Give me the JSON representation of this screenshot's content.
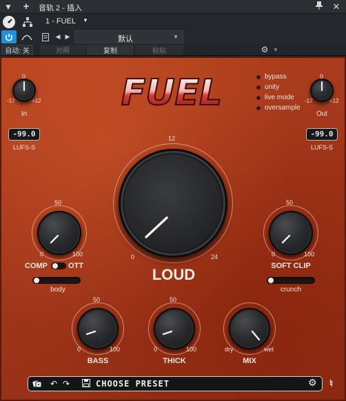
{
  "window": {
    "title": "音轨 2 - 插入",
    "menu_icon": "triangle-down-icon",
    "add_icon": "plus-icon",
    "pin_icon": "pin-icon",
    "close_icon": "close-icon"
  },
  "toolbar": {
    "power_icon": "power-icon",
    "routing_icon": "routing-icon",
    "plugin_selector": "1 - FUEL",
    "auto_label": "自动: 关",
    "compare_label": "对照",
    "copy_label": "复制",
    "paste_label": "粘贴",
    "preset_name": "默认"
  },
  "plugin": {
    "logo": "FUEL",
    "options": [
      "bypass",
      "unity",
      "live mode",
      "oversample"
    ],
    "in": {
      "label": "In",
      "min": "-17",
      "max": "+12",
      "center": "0",
      "lufs": "-99.0",
      "lufs_label": "LUFS-S"
    },
    "out": {
      "label": "Out",
      "min": "-17",
      "max": "+12",
      "center": "0",
      "lufs": "-99.0",
      "lufs_label": "LUFS-S"
    },
    "loud": {
      "label": "LOUD",
      "min": "0",
      "max": "24",
      "top": "12"
    },
    "comp": {
      "left_label": "COMP",
      "right_label": "OTT",
      "min": "0",
      "max": "100",
      "top": "50",
      "slider_label": "body"
    },
    "softclip": {
      "label": "SOFT CLIP",
      "min": "0",
      "max": "100",
      "top": "50",
      "slider_label": "crunch"
    },
    "bass": {
      "label": "BASS",
      "min": "0",
      "max": "100",
      "top": "50"
    },
    "thick": {
      "label": "THICK",
      "min": "0",
      "max": "100",
      "top": "50"
    },
    "mix": {
      "label": "MIX",
      "min": "dry",
      "max": "wet"
    },
    "preset_bar": {
      "preset_label": "CHOOSE PRESET"
    }
  }
}
